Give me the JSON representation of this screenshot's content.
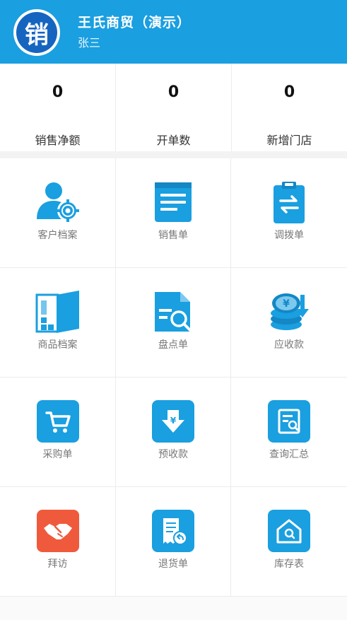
{
  "header": {
    "logo_char": "销",
    "shop_name": "王氏商贸（演示）",
    "user_name": "张三",
    "bg_color": "#1a9fe0"
  },
  "stats": [
    {
      "value": "0",
      "label": "销售净额"
    },
    {
      "value": "0",
      "label": "开单数"
    },
    {
      "value": "0",
      "label": "新增门店"
    }
  ],
  "menu": [
    {
      "label": "客户档案",
      "icon": "customer-settings-icon"
    },
    {
      "label": "销售单",
      "icon": "sales-document-icon"
    },
    {
      "label": "调拨单",
      "icon": "transfer-clipboard-icon"
    },
    {
      "label": "商品档案",
      "icon": "product-door-icon"
    },
    {
      "label": "盘点单",
      "icon": "inventory-search-icon"
    },
    {
      "label": "应收款",
      "icon": "coins-receivable-icon"
    },
    {
      "label": "采购单",
      "icon": "shopping-cart-icon"
    },
    {
      "label": "预收款",
      "icon": "yen-download-icon"
    },
    {
      "label": "查询汇总",
      "icon": "report-search-icon"
    },
    {
      "label": "拜访",
      "icon": "handshake-icon"
    },
    {
      "label": "退货单",
      "icon": "return-receipt-icon"
    },
    {
      "label": "库存表",
      "icon": "warehouse-home-icon"
    }
  ],
  "colors": {
    "primary": "#1a9fe0",
    "visit": "#f05a3c"
  }
}
